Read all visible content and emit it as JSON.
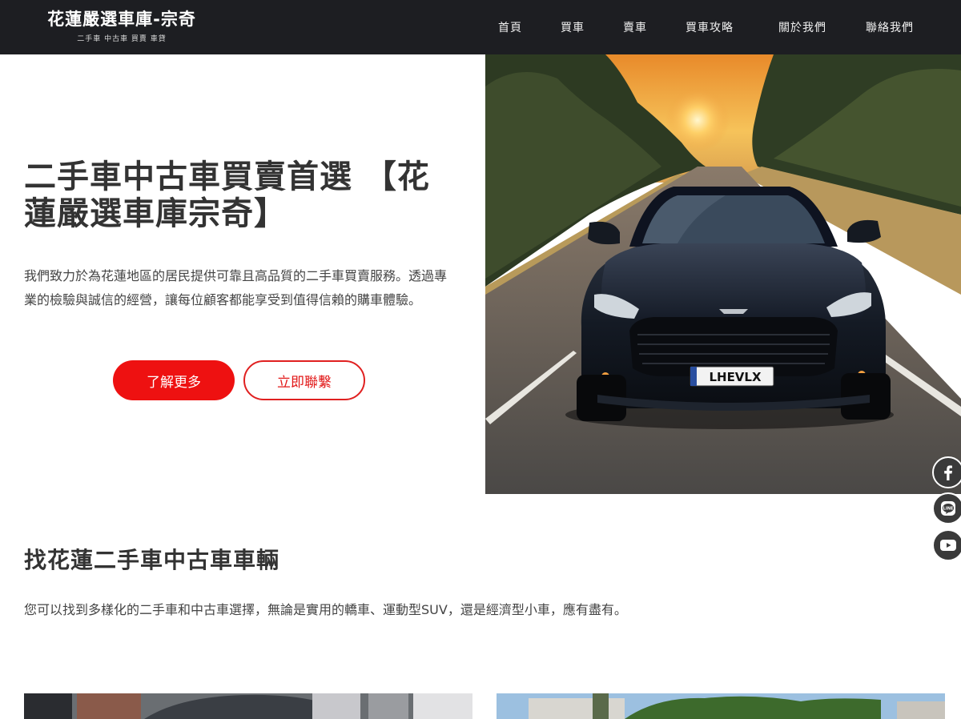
{
  "header": {
    "logo_title": "花蓮嚴選車庫-宗奇",
    "logo_subtitle": "二手車 中古車 買賣 車貸",
    "nav": [
      {
        "label": "首頁"
      },
      {
        "label": "買車"
      },
      {
        "label": "賣車"
      },
      {
        "label": "買車攻略"
      },
      {
        "label": "關於我們"
      },
      {
        "label": "聯絡我們"
      }
    ]
  },
  "hero": {
    "title": "二手車中古車買賣首選 【花蓮嚴選車庫宗奇】",
    "description": "我們致力於為花蓮地區的居民提供可靠且高品質的二手車買賣服務。透過專業的檢驗與誠信的經營，讓每位顧客都能享受到值得信賴的購車體驗。",
    "primary_button": "了解更多",
    "secondary_button": "立即聯繫",
    "license_plate": "LHEVLX"
  },
  "social": [
    {
      "icon": "facebook-icon"
    },
    {
      "icon": "line-icon"
    },
    {
      "icon": "youtube-icon"
    }
  ],
  "section": {
    "title": "找花蓮二手車中古車車輛",
    "description": "您可以找到多樣化的二手車和中古車選擇，無論是實用的轎車、運動型SUV，還是經濟型小車，應有盡有。"
  },
  "colors": {
    "header_bg": "#1d1e22",
    "accent_red": "#ee1111",
    "social_bg": "#3a3a3a"
  }
}
